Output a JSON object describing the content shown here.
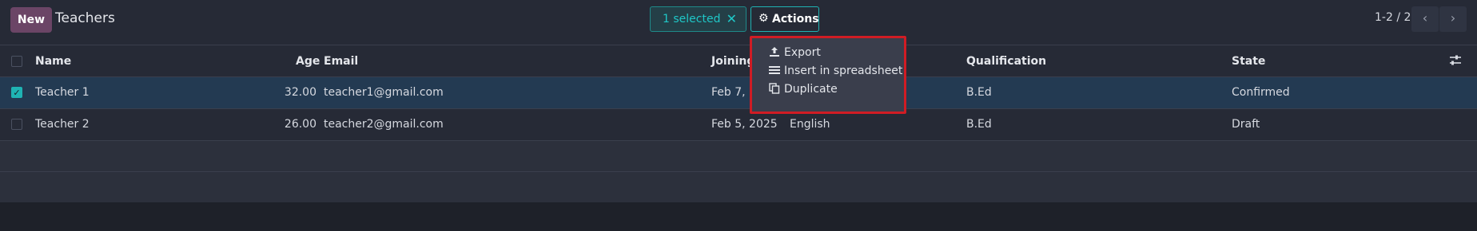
{
  "header": {
    "new_label": "New",
    "title": "Teachers",
    "selected_label": "1 selected",
    "clear_selection": "✕",
    "actions_label": "Actions",
    "pager": "1-2 / 2",
    "prev": "‹",
    "next": "›"
  },
  "actions_menu": [
    {
      "label": "Export",
      "icon": "export-icon"
    },
    {
      "label": "Insert in spreadsheet",
      "icon": "spreadsheet-icon"
    },
    {
      "label": "Duplicate",
      "icon": "duplicate-icon"
    }
  ],
  "table": {
    "columns": [
      "Name",
      "Age",
      "Email",
      "Joining",
      "Qualification",
      "State"
    ],
    "rows": [
      {
        "name": "Teacher 1",
        "age": "32.00",
        "email": "teacher1@gmail.com",
        "joining": "Feb 7, 2",
        "language": "",
        "qualification": "B.Ed",
        "state": "Confirmed",
        "selected": true
      },
      {
        "name": "Teacher 2",
        "age": "26.00",
        "email": "teacher2@gmail.com",
        "joining": "Feb 5, 2025",
        "language": "English",
        "qualification": "B.Ed",
        "state": "Draft",
        "selected": false
      }
    ]
  },
  "colors": {
    "accent": "#1fb3b3",
    "new_button": "#6b4566",
    "highlight_border": "#d01c24",
    "selected_row": "#233a52"
  }
}
